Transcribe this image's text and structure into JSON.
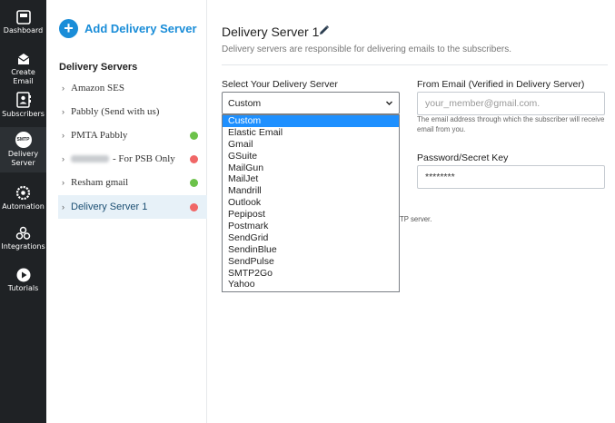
{
  "nav": {
    "items": [
      {
        "label": "Dashboard",
        "icon": "dashboard-icon"
      },
      {
        "label": "Create Email",
        "icon": "envelope-icon"
      },
      {
        "label": "Subscribers",
        "icon": "subscribers-icon"
      },
      {
        "label": "Delivery Server",
        "icon": "smtp-icon",
        "badge": "SMTP",
        "active": true
      },
      {
        "label": "Automation",
        "icon": "gear-icon"
      },
      {
        "label": "Integrations",
        "icon": "integrations-icon"
      },
      {
        "label": "Tutorials",
        "icon": "play-icon"
      }
    ]
  },
  "server_list": {
    "add_label": "Add Delivery Server",
    "heading": "Delivery Servers",
    "items": [
      {
        "name": "Amazon SES",
        "status": null
      },
      {
        "name": "Pabbly (Send with us)",
        "status": null
      },
      {
        "name": "PMTA Pabbly",
        "status": "green"
      },
      {
        "name": "- For PSB Only",
        "status": "red",
        "redacted": true
      },
      {
        "name": "Resham gmail",
        "status": "green"
      },
      {
        "name": "Delivery Server 1",
        "status": "red",
        "active": true
      }
    ]
  },
  "main": {
    "title": "Delivery Server 1",
    "subtitle": "Delivery servers are responsible for delivering emails to the subscribers.",
    "select_label": "Select Your Delivery Server",
    "select_value": "Custom",
    "options": [
      "Custom",
      "Elastic Email",
      "Gmail",
      "GSuite",
      "MailGun",
      "MailJet",
      "Mandrill",
      "Outlook",
      "Pepipost",
      "Postmark",
      "SendGrid",
      "SendinBlue",
      "SendPulse",
      "SMTP2Go",
      "Yahoo"
    ],
    "from_email_label": "From Email (Verified in Delivery Server)",
    "from_email_placeholder": "your_member@gmail.com.",
    "from_email_help": "The email address through which the subscriber will receive email from you.",
    "password_label": "Password/Secret Key",
    "password_value": "********",
    "obscured_text": "TP server."
  },
  "colors": {
    "accent": "#1a8dd8",
    "status_green": "#6cc24a",
    "status_red": "#f06767",
    "rail_bg": "#1f2225"
  }
}
